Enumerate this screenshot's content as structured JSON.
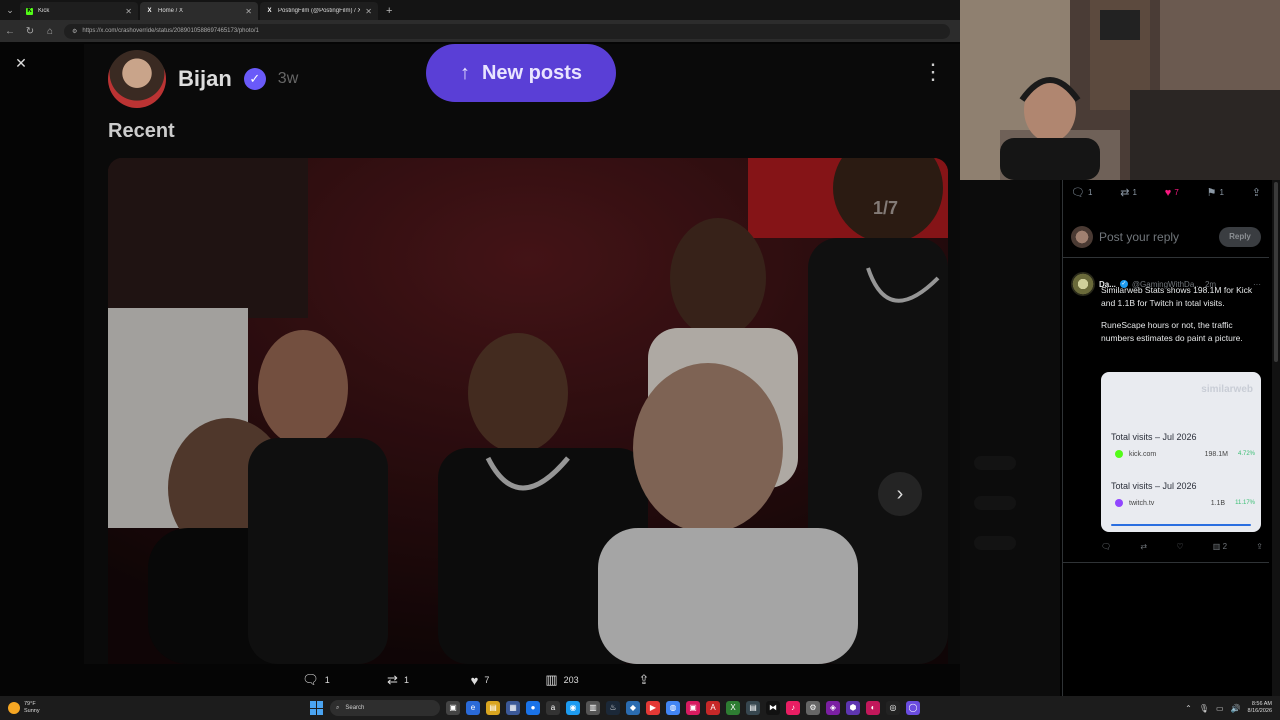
{
  "browser": {
    "tabs": [
      {
        "label": "Kick",
        "favicon": "kick-logo",
        "active": false
      },
      {
        "label": "Home / X",
        "favicon": "x-logo",
        "active": true
      },
      {
        "label": "PostingFilm (@PostingFilm) / X",
        "favicon": "x-logo",
        "active": false
      }
    ],
    "new_tab": "+",
    "url": "https://x.com/crashoverride/status/2089010588697465173/photo/1"
  },
  "viewer": {
    "author_name": "Bijan",
    "author_time": "3w",
    "section_label": "Recent",
    "new_posts_label": "New posts",
    "photo_counter": "1/7",
    "actions": {
      "replies": "1",
      "reposts": "1",
      "likes": "7",
      "views": "203"
    }
  },
  "sidebar": {
    "stats": {
      "replies": "1",
      "reposts": "1",
      "likes": "7",
      "bookmarks": "1"
    },
    "reply_placeholder": "Post your reply",
    "reply_button": "Reply",
    "tweet": {
      "name": "Da...",
      "handle": "@GamingWithDa...",
      "time": "2m",
      "paragraph1": "Similarweb Stats shows 198.1M for Kick and 1.1B for Twitch in total visits.",
      "paragraph2": "RuneScape hours or not, the traffic numbers estimates do paint a picture.",
      "card": {
        "logo": "similarweb",
        "block1_title": "Total visits – Jul 2026",
        "block1_site": "kick.com",
        "block1_value": "198.1M",
        "block1_change": "4.72%",
        "block2_title": "Total visits – Jul 2026",
        "block2_site": "twitch.tv",
        "block2_value": "1.1B",
        "block2_change": "11.17%"
      },
      "actions": {
        "likes": "",
        "views": "2"
      }
    }
  },
  "taskbar": {
    "weather_temp": "79°F",
    "weather_desc": "Sunny",
    "search_placeholder": "Search",
    "time": "8:56 AM",
    "date": "8/16/2026"
  },
  "colors": {
    "accent_x_blue": "#1d9bf0",
    "like_pink": "#f91880",
    "new_posts_purple": "#5a3fd6",
    "kick_green": "#53fc18"
  }
}
